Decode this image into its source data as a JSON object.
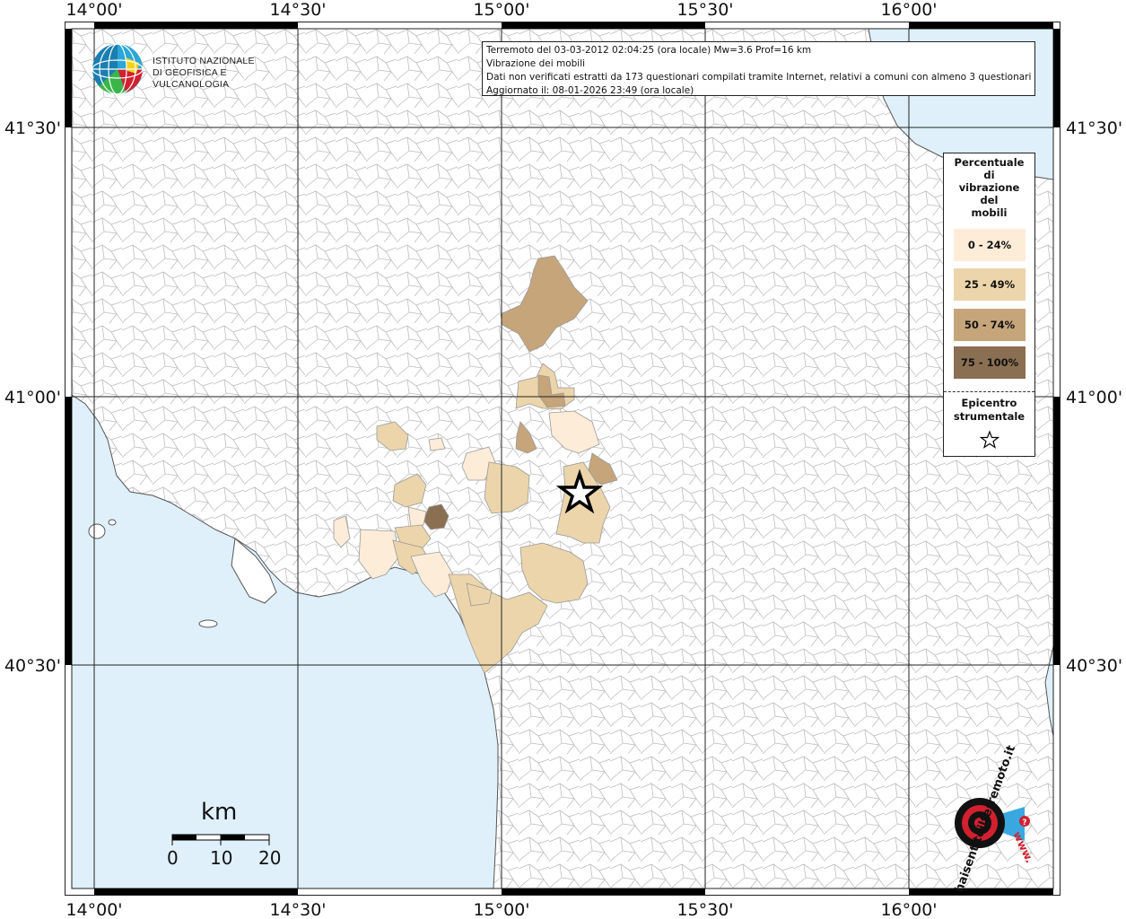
{
  "map": {
    "title": "Vibrazione dei mobili",
    "info": {
      "line1": "Terremoto del 03-03-2012 02:04:25 (ora locale) Mw=3.6 Prof=16 km",
      "line2": "Vibrazione dei mobili",
      "line3": "Dati non verificati estratti da 173 questionari compilati tramite Internet, relativi a comuni con almeno 3 questionari.",
      "line4": "Aggiornato il: 08-01-2026 23:49 (ora locale)"
    },
    "lon_labels": [
      "14°00'",
      "14°30'",
      "15°00'",
      "15°30'",
      "16°00'"
    ],
    "lat_labels": [
      "41°30'",
      "41°00'",
      "40°30'"
    ],
    "colors": {
      "sea": "#dff0fb",
      "land": "#ffffff",
      "border": "#b8b8b8",
      "grid": "#222222",
      "class_0_24": "#fdecd8",
      "class_25_49": "#ecd5ab",
      "class_50_74": "#c6a57b",
      "class_75_100": "#8a6f52"
    }
  },
  "legend": {
    "title_lines": [
      "Percentuale",
      "di",
      "vibrazione",
      "del",
      "mobili"
    ],
    "items": [
      {
        "label": "0 - 24%",
        "color": "#fdecd8"
      },
      {
        "label": "25 - 49%",
        "color": "#ecd5ab"
      },
      {
        "label": "50 - 74%",
        "color": "#c6a57b"
      },
      {
        "label": "75 - 100%",
        "color": "#8a6f52"
      }
    ],
    "epicenter_lines": [
      "Epicentro",
      "strumentale"
    ],
    "epicenter_icon": "star-icon"
  },
  "logo": {
    "line1": "ISTITUTO NAZIONALE",
    "line2": "DI GEOFISICA E VULCANOLOGIA",
    "icon": "ingv-globe-icon"
  },
  "scale": {
    "unit": "km",
    "ticks": [
      "0",
      "10",
      "20"
    ]
  },
  "hsi": {
    "text": "haisentitoilterremoto.it",
    "url_text": "www.",
    "icon": "hsi-target-icon"
  }
}
